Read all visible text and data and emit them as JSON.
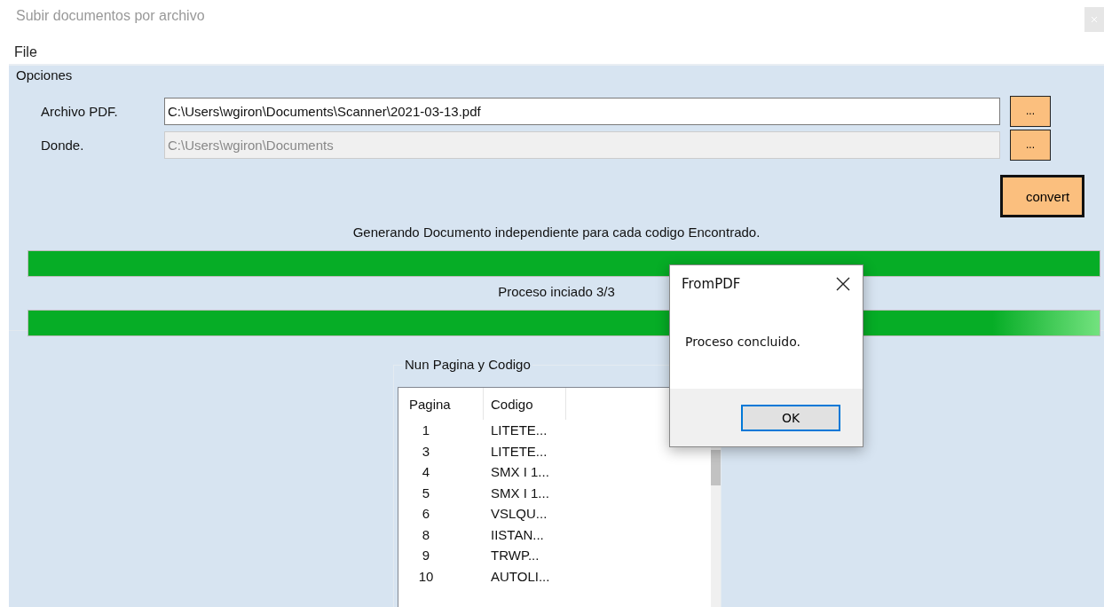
{
  "window": {
    "title": "Subir documentos por archivo"
  },
  "menu": [
    "File"
  ],
  "options": {
    "title": "Opciones",
    "fields": [
      {
        "label": "Archivo PDF.",
        "value": "C:\\Users\\wgiron\\Documents\\Scanner\\2021-03-13.pdf",
        "disabled": false,
        "button": "..."
      },
      {
        "label": "Donde.",
        "value": "C:\\Users\\wgiron\\Documents",
        "disabled": true,
        "button": "..."
      }
    ],
    "convert_button": "convert"
  },
  "progress": [
    {
      "label": "Generando Documento independiente para cada codigo Encontrado.",
      "level": 1
    },
    {
      "label": "Proceso inciado 3/3",
      "level": 1
    }
  ],
  "list_group": {
    "title": "Nun Pagina y Codigo",
    "columns": [
      "Pagina",
      "Codigo"
    ],
    "rows": [
      [
        "1",
        "LITETE..."
      ],
      [
        "3",
        "LITETE..."
      ],
      [
        "4",
        "SMX I 1..."
      ],
      [
        "5",
        "SMX I 1..."
      ],
      [
        "6",
        "VSLQU..."
      ],
      [
        "8",
        "IISTAN..."
      ],
      [
        "9",
        "TRWP..."
      ],
      [
        "10",
        "AUTOLI..."
      ]
    ]
  },
  "dialog": {
    "title": "FromPDF",
    "message": "Proceso concluido.",
    "button": "OK"
  }
}
